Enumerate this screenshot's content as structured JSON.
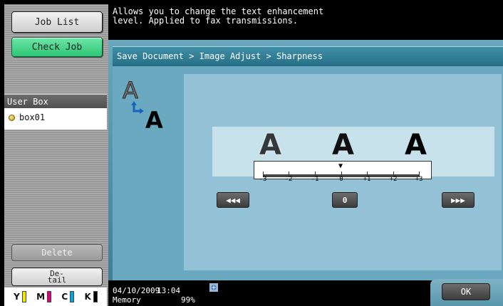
{
  "sidebar": {
    "job_list": "Job List",
    "check_job": "Check Job",
    "user_box_header": "User Box",
    "box_item": "box01",
    "delete": "Delete",
    "detail": "De-\ntail",
    "toner": [
      {
        "letter": "Y",
        "color": "#f2e600"
      },
      {
        "letter": "M",
        "color": "#e0007a"
      },
      {
        "letter": "C",
        "color": "#00a7e1"
      },
      {
        "letter": "K",
        "color": "#000000"
      }
    ]
  },
  "message": "Allows you to change the text enhancement\nlevel. Applied to fax transmissions.",
  "breadcrumb": "Save Document > Image Adjust > Sharpness",
  "sharpness": {
    "letter": "A",
    "scale_labels": [
      "-3",
      "-2",
      "-1",
      "0",
      "+1",
      "+2",
      "+3"
    ],
    "current_value": 0,
    "decrease_label": "◀◀◀",
    "reset_label": "0",
    "increase_label": "▶▶▶"
  },
  "status": {
    "date": "04/10/2009",
    "time": "13:04",
    "memory_label": "Memory",
    "memory_percent": "99%"
  },
  "ok_label": "OK",
  "colors": {
    "check_job": "#2cc678",
    "panel": "#6aa9bf",
    "breadcrumb": "#266f86"
  }
}
